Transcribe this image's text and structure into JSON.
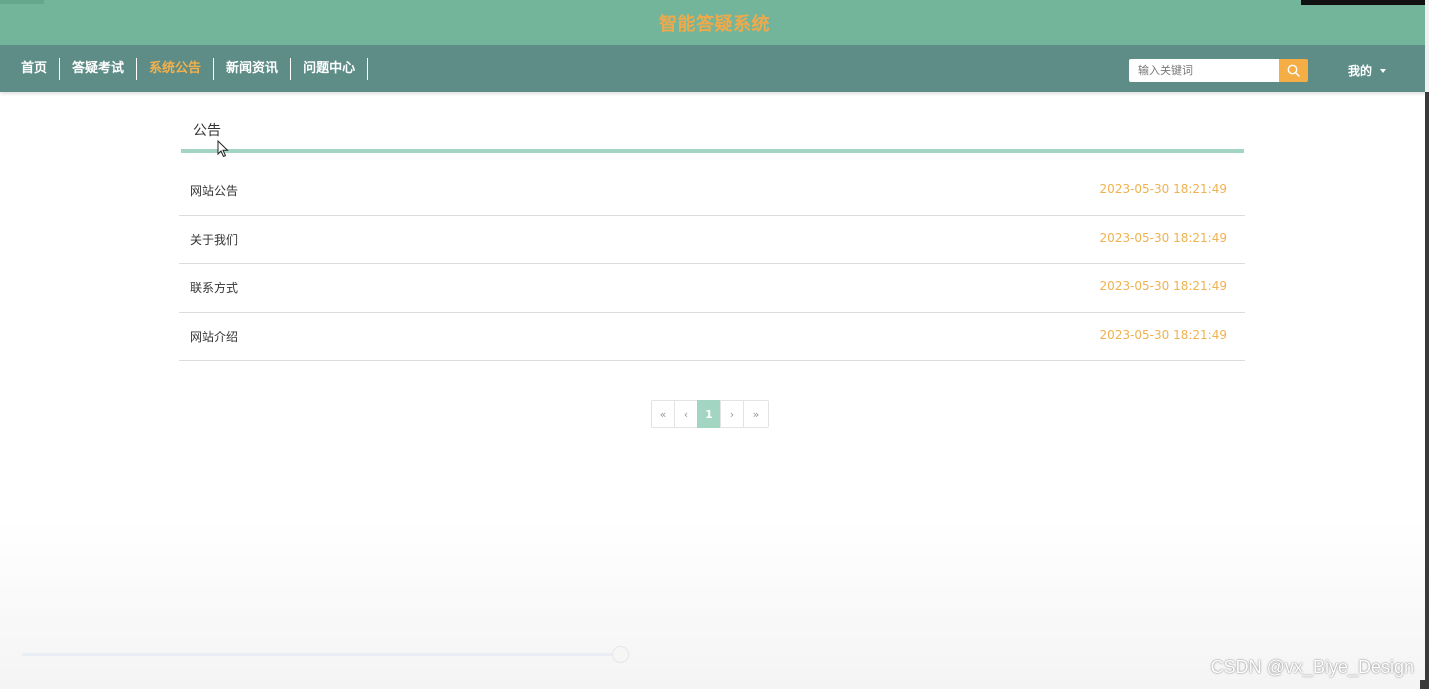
{
  "header": {
    "title": "智能答疑系统"
  },
  "nav": {
    "items": [
      {
        "label": "首页",
        "active": false
      },
      {
        "label": "答疑考试",
        "active": false
      },
      {
        "label": "系统公告",
        "active": true
      },
      {
        "label": "新闻资讯",
        "active": false
      },
      {
        "label": "问题中心",
        "active": false
      }
    ],
    "search": {
      "placeholder": "输入关键词",
      "value": "",
      "button_icon": "search-icon"
    },
    "user_menu": {
      "label": "我的",
      "icon": "caret-down-icon"
    }
  },
  "section": {
    "title": "公告"
  },
  "notices": [
    {
      "title": "网站公告",
      "time": "2023-05-30 18:21:49"
    },
    {
      "title": "关于我们",
      "time": "2023-05-30 18:21:49"
    },
    {
      "title": "联系方式",
      "time": "2023-05-30 18:21:49"
    },
    {
      "title": "网站介绍",
      "time": "2023-05-30 18:21:49"
    }
  ],
  "pagination": {
    "first": "«",
    "prev": "‹",
    "current": "1",
    "next": "›",
    "last": "»"
  },
  "watermark": "CSDN @vx_Biye_Design",
  "colors": {
    "title_bar": "#73b59a",
    "nav_bar": "#5e8d88",
    "accent": "#f0b14e",
    "section_line": "#a3d5c3",
    "search_button": "#f5ae45"
  }
}
